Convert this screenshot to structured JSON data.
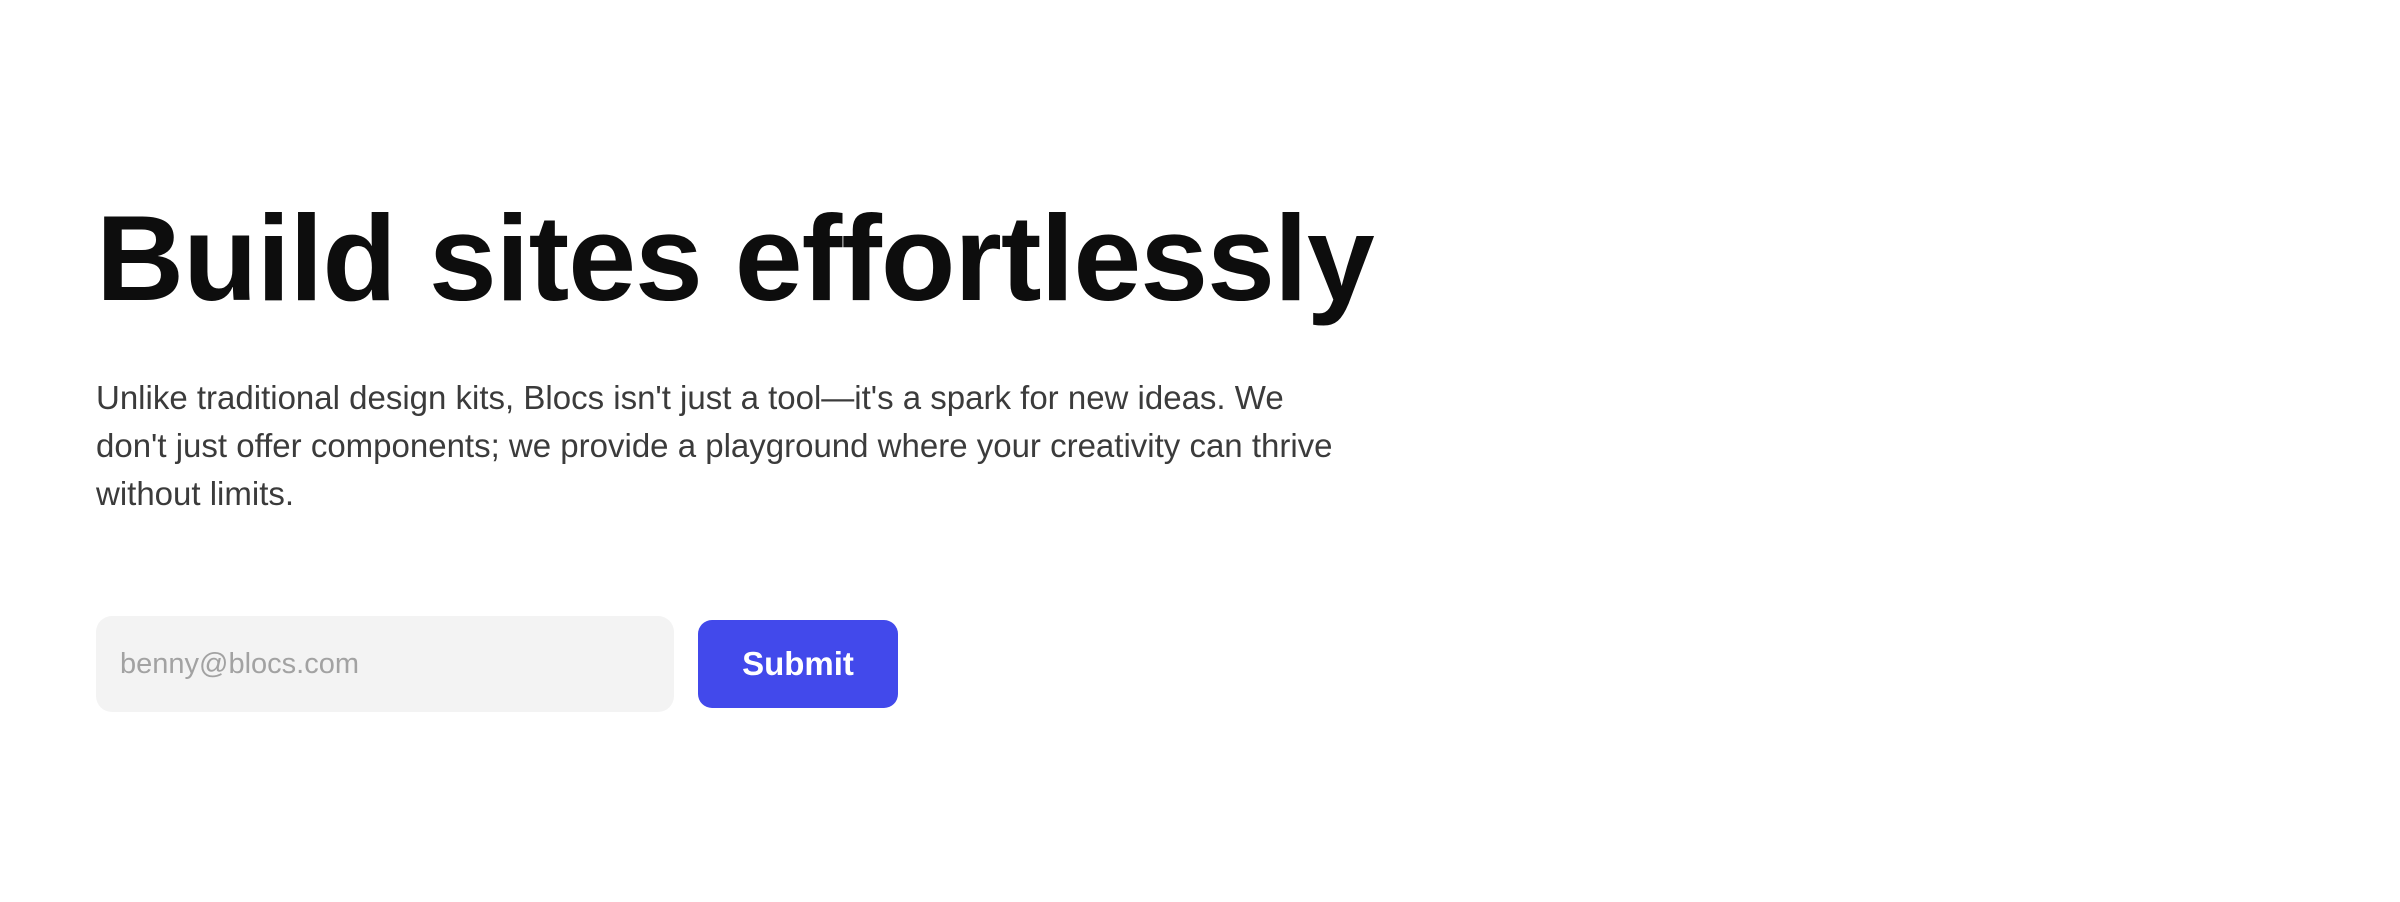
{
  "hero": {
    "title": "Build sites effortlessly",
    "description": "Unlike traditional design kits, Blocs isn't just a tool—it's a spark for new ideas. We don't just offer components; we provide a playground where your creativity can thrive without limits."
  },
  "signup": {
    "email_placeholder": "benny@blocs.com",
    "email_value": "",
    "submit_label": "Submit"
  },
  "colors": {
    "button_accent": "#4249EB",
    "heading_text": "#0D0D0D",
    "body_text": "#3B3B3B",
    "input_background": "#F3F3F3"
  }
}
